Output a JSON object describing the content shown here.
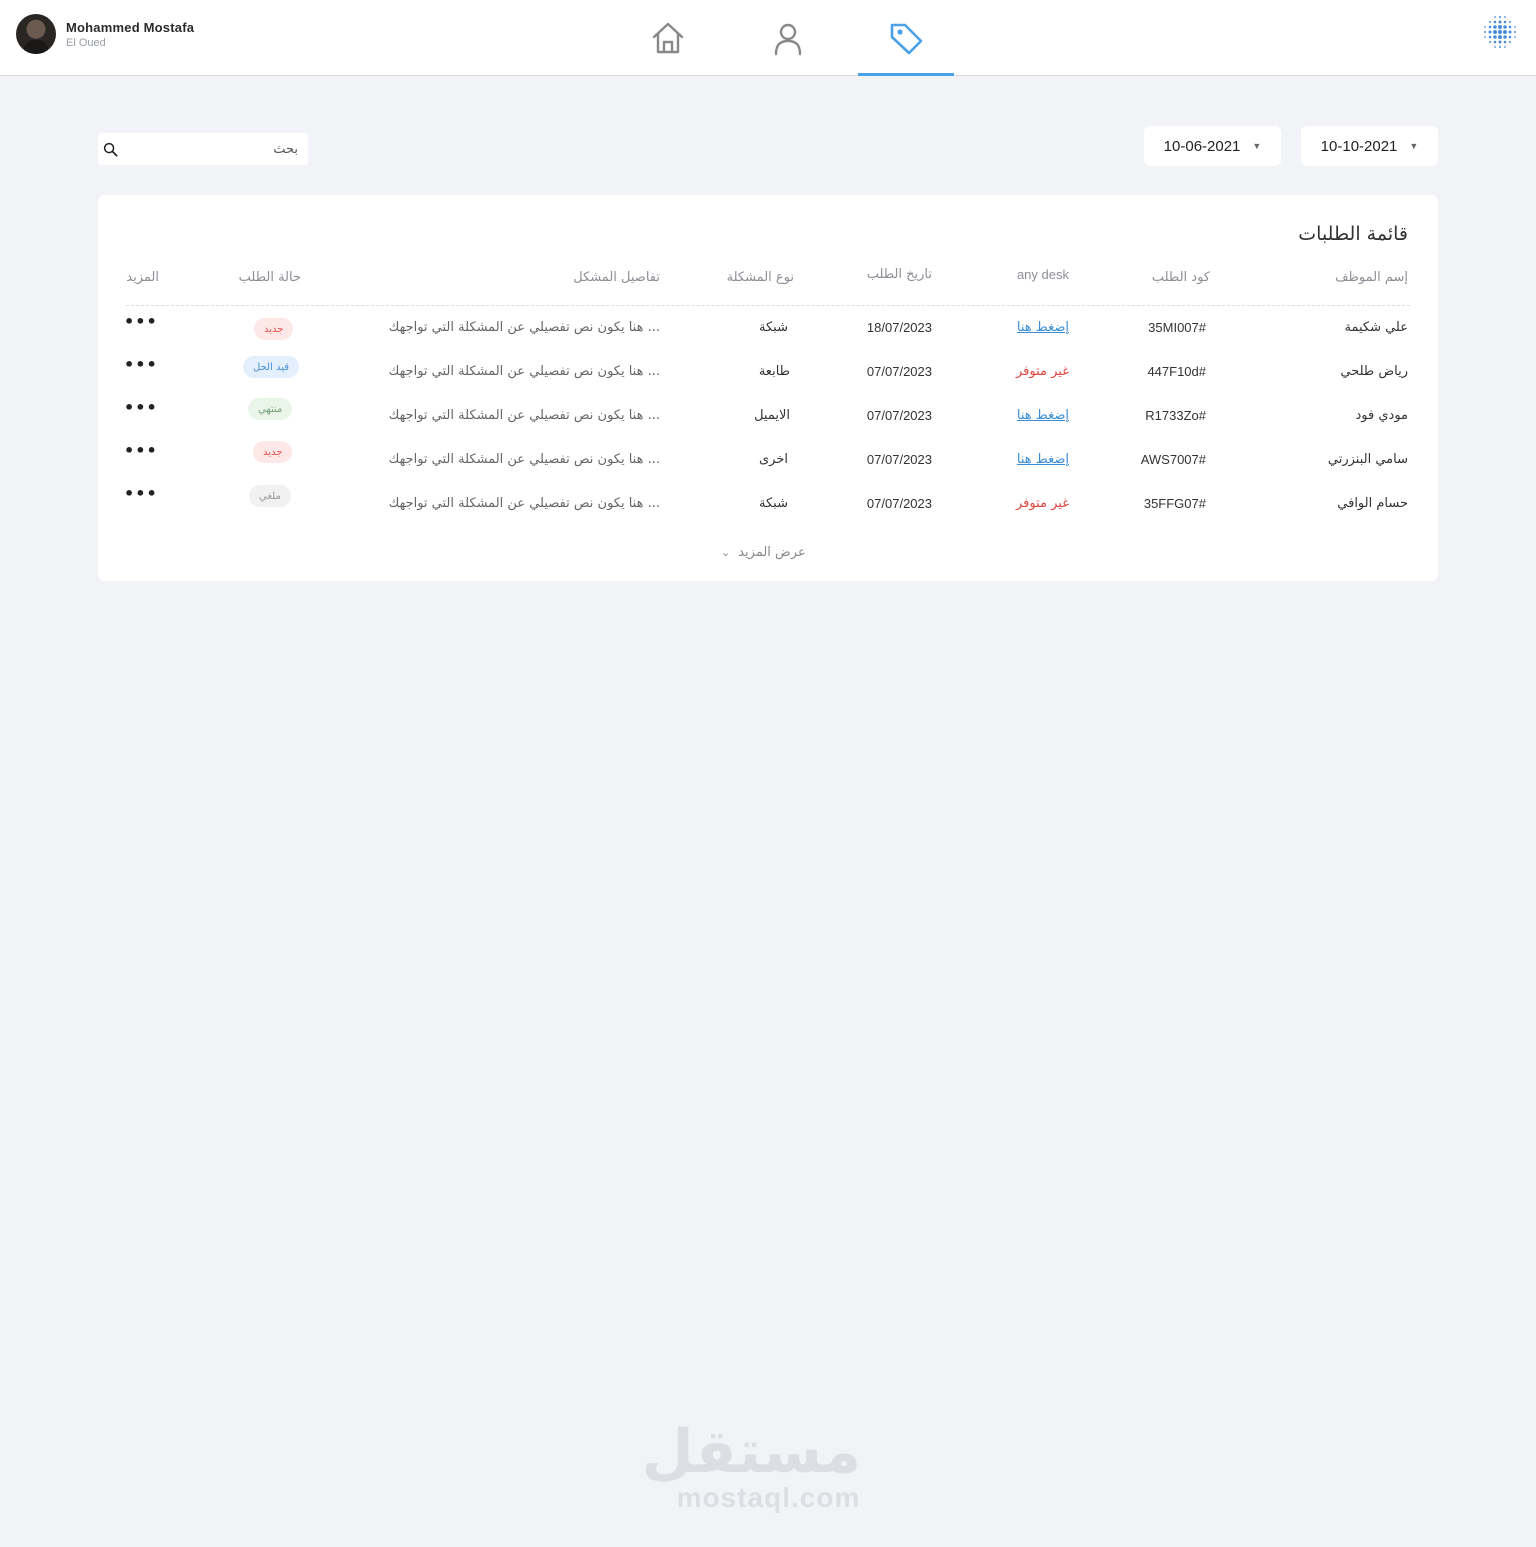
{
  "user": {
    "name": "Mohammed Mostafa",
    "city": "El Oued"
  },
  "nav": {
    "tabs": [
      {
        "icon": "home-icon"
      },
      {
        "icon": "user-icon"
      },
      {
        "icon": "tag-icon",
        "active": true
      }
    ],
    "accent": "#4aa1e6"
  },
  "filters": {
    "date_from": "10-10-2021",
    "date_to": "10-06-2021",
    "search_placeholder": "بحث"
  },
  "card": {
    "title": "قائمة الطلبات",
    "columns": {
      "employee": "إسم الموظف",
      "code": "كود الطلب",
      "anydesk": "any desk",
      "date": "تاريخ الطلب",
      "type": "نوع المشكلة",
      "details": "تفاصيل المشكل",
      "status": "حالة الطلب",
      "more": "المزيد"
    },
    "rows": [
      {
        "employee": "علي شكيمة",
        "code": "35MI007#",
        "anydesk": "إضغط هنا",
        "date": "18/07/2023",
        "type": "شبكة",
        "details": "هنا يكون نص تفصيلي عن المشكلة  التي تواجهك ...",
        "status": "جديد",
        "more": "•••"
      },
      {
        "employee": "رياض طلحي",
        "code": "447F10d#",
        "anydesk": "غير متوفر",
        "date": "07/07/2023",
        "type": "طابعة",
        "details": "هنا يكون نص تفصيلي عن المشكلة  التي تواجهك ...",
        "status": "قيد الحل",
        "more": "•••"
      },
      {
        "employee": "مودي فود",
        "code": "R1733Zo#",
        "anydesk": "إضغط هنا",
        "date": "07/07/2023",
        "type": "الايميل",
        "details": "هنا يكون نص تفصيلي عن المشكلة  التي تواجهك ...",
        "status": "منتهي",
        "more": "•••"
      },
      {
        "employee": "سامي البنزرتي",
        "code": "AWS7007#",
        "anydesk": "إضغط هنا",
        "date": "07/07/2023",
        "type": "اخرى",
        "details": "هنا يكون نص تفصيلي عن المشكلة  التي تواجهك ...",
        "status": "جديد",
        "more": "•••"
      },
      {
        "employee": "حسام الوافي",
        "code": "35FFG07#",
        "anydesk": "غير متوفر",
        "date": "07/07/2023",
        "type": "شبكة",
        "details": "هنا يكون نص تفصيلي عن المشكلة  التي تواجهك ...",
        "status": "ملغي",
        "more": "•••"
      }
    ],
    "show_more": "عرض المزيد"
  },
  "watermark": {
    "arabic": "مستقل",
    "latin": "mostaql.com"
  },
  "colors": {
    "link": "#3a8ed8",
    "unavailable": "#e0453f",
    "status_new": "#e45050",
    "status_progress": "#4a8fd6",
    "status_done": "#7aa07a",
    "status_cancel": "#999999"
  }
}
